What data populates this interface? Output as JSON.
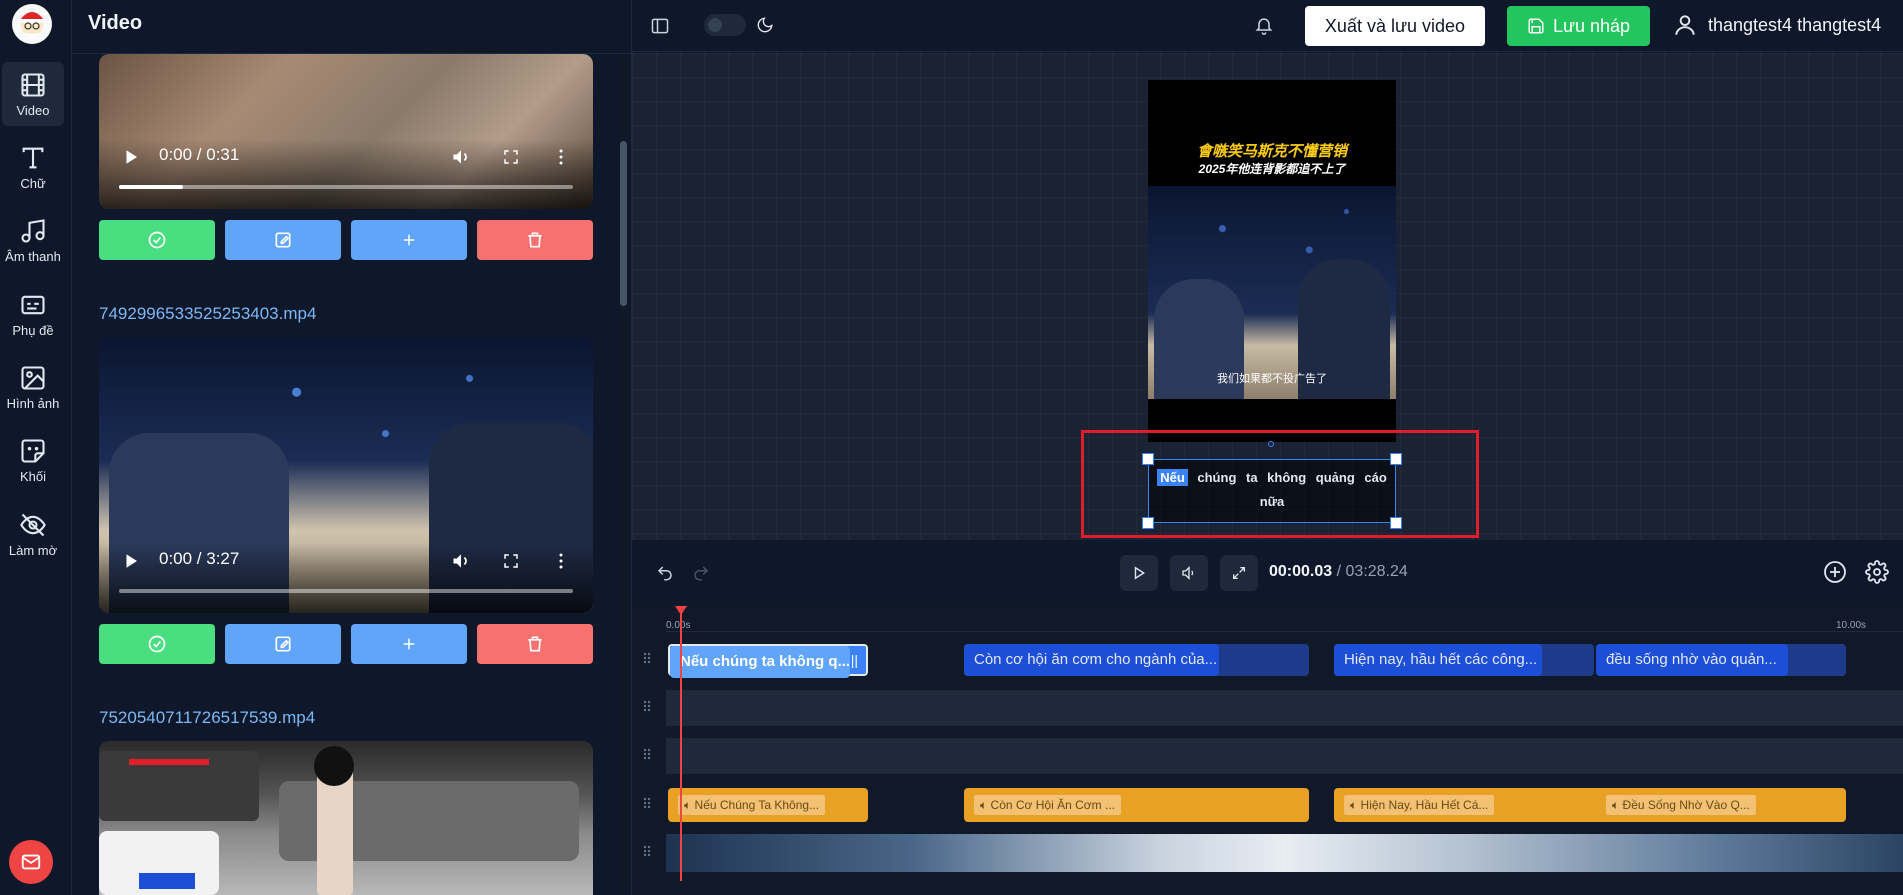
{
  "rail": {
    "items": [
      {
        "label": "Video",
        "icon": "film-icon"
      },
      {
        "label": "Chữ",
        "icon": "text-icon"
      },
      {
        "label": "Âm thanh",
        "icon": "music-icon"
      },
      {
        "label": "Phụ đề",
        "icon": "subtitles-icon"
      },
      {
        "label": "Hình ảnh",
        "icon": "image-icon"
      },
      {
        "label": "Khối",
        "icon": "sticker-icon"
      },
      {
        "label": "Làm mờ",
        "icon": "eye-off-icon"
      }
    ]
  },
  "panel": {
    "title": "Video",
    "videos": [
      {
        "filename": "",
        "time": "0:00 / 0:31",
        "progress": 0.14
      },
      {
        "filename": "7492996533525253403.mp4",
        "time": "0:00 / 3:27",
        "progress": 0.0
      },
      {
        "filename": "7520540711726517539.mp4",
        "time": "",
        "progress": 0.0
      }
    ]
  },
  "topbar": {
    "export_label": "Xuất và lưu video",
    "save_label": "Lưu nháp",
    "username": "thangtest4 thangtest4"
  },
  "preview": {
    "cn_title": "會嗾笑马斯克不懂营销",
    "cn_subtitle": "2025年他连背影都追不上了",
    "cn_caption": "我们如果都不投广告了",
    "subtitle_first_word": "Nếu",
    "subtitle_rest": "chúng ta không quảng cáo nữa"
  },
  "playback": {
    "current": "00:00.03",
    "separator": "/",
    "duration": "03:28.24"
  },
  "timeline": {
    "ruler_start": "0.00s",
    "ruler_end": "10.00s",
    "text_clips": [
      "Nếu chúng ta không q...",
      "Còn cơ hội ăn cơm cho ngành của...",
      "Hiện nay, hầu hết các công...",
      "đều sống nhờ vào quản..."
    ],
    "audio_clips": [
      "Nếu Chúng Ta Không...",
      "Còn Cơ Hội Ăn Cơm ...",
      "Hiện Nay, Hầu Hết Cá...",
      "Đều Sống Nhờ Vào Q..."
    ]
  },
  "colors": {
    "accent_green": "#22c55e",
    "accent_blue": "#3b82f6",
    "audio_orange": "#e9a125",
    "highlight_red": "#e11d2a"
  }
}
